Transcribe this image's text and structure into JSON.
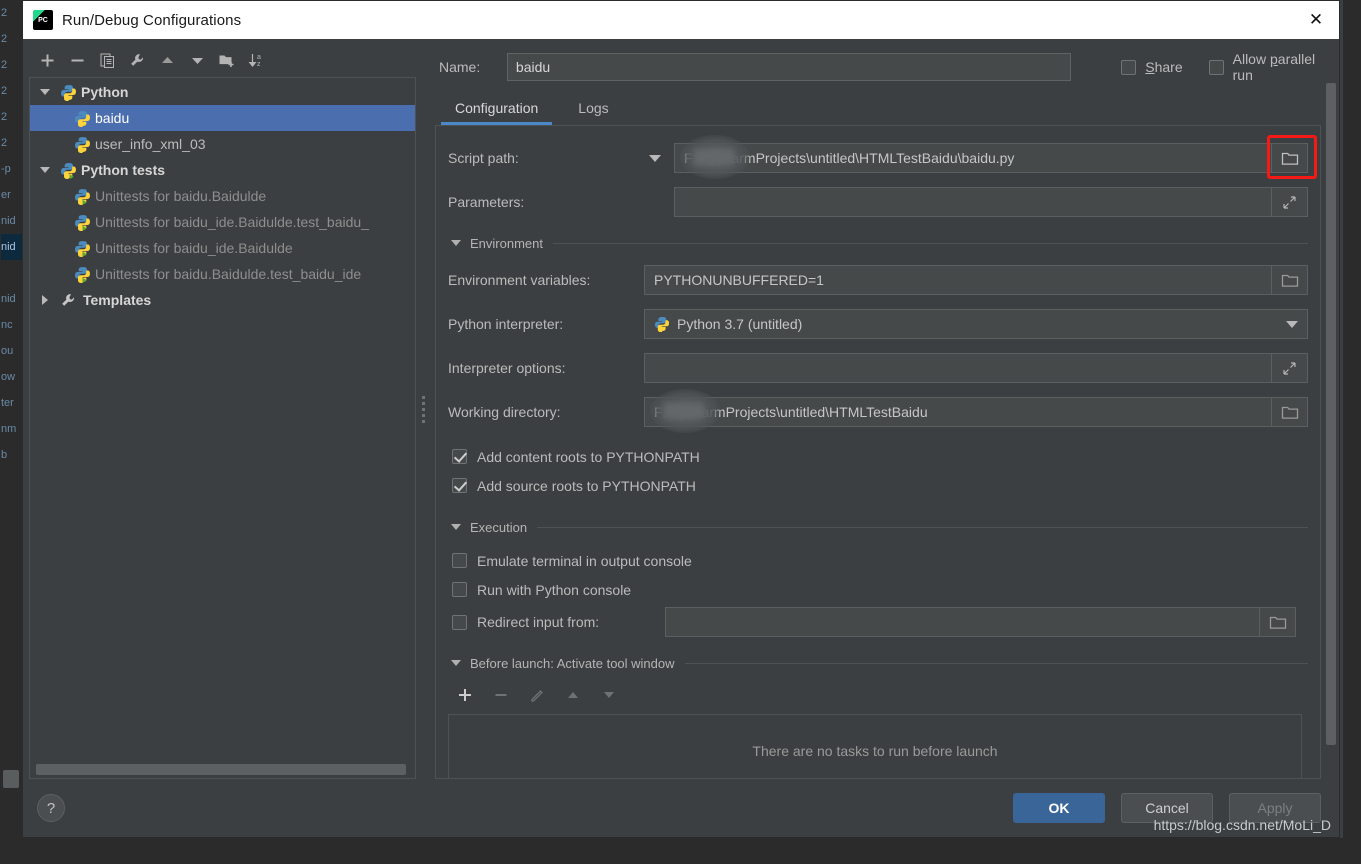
{
  "window": {
    "title": "Run/Debug Configurations",
    "app_icon": "pycharm-logo-icon",
    "close_label": "✕"
  },
  "toolbar": {
    "buttons": [
      {
        "name": "add-configuration-button",
        "icon": "plus-icon"
      },
      {
        "name": "remove-configuration-button",
        "icon": "minus-icon"
      },
      {
        "name": "copy-configuration-button",
        "icon": "copy-icon"
      },
      {
        "name": "edit-templates-button",
        "icon": "wrench-icon"
      },
      {
        "name": "move-up-button",
        "icon": "arrow-up-icon"
      },
      {
        "name": "move-down-button",
        "icon": "arrow-down-icon"
      },
      {
        "name": "new-folder-button",
        "icon": "folder-add-icon"
      },
      {
        "name": "sort-configurations-button",
        "icon": "sort-az-icon"
      }
    ]
  },
  "tree": {
    "nodes": [
      {
        "label": "Python",
        "type": "group",
        "expanded": true,
        "icon": "python-icon"
      },
      {
        "label": "baidu",
        "type": "child",
        "selected": true,
        "icon": "python-icon"
      },
      {
        "label": "user_info_xml_03",
        "type": "child",
        "selected": false,
        "icon": "python-icon"
      },
      {
        "label": "Python tests",
        "type": "group",
        "expanded": true,
        "icon": "python-test-icon"
      },
      {
        "label": "Unittests for baidu.Baidulde",
        "type": "child",
        "dim": true,
        "icon": "python-test-icon"
      },
      {
        "label": "Unittests for baidu_ide.Baidulde.test_baidu_",
        "type": "child",
        "dim": true,
        "icon": "python-test-icon"
      },
      {
        "label": "Unittests for baidu_ide.Baidulde",
        "type": "child",
        "dim": true,
        "icon": "python-test-icon"
      },
      {
        "label": "Unittests for baidu.Baidulde.test_baidu_ide",
        "type": "child",
        "dim": true,
        "icon": "python-test-icon"
      },
      {
        "label": "Templates",
        "type": "group",
        "expanded": false,
        "icon": "wrench-icon"
      }
    ]
  },
  "form": {
    "name_label": "Name:",
    "name_value": "baidu",
    "share_label": "Share",
    "share_checked": false,
    "allow_parallel_label": "Allow parallel run",
    "allow_parallel_checked": false,
    "tabs": [
      {
        "label": "Configuration",
        "active": true
      },
      {
        "label": "Logs",
        "active": false
      }
    ],
    "script_path_label": "Script path:",
    "script_path_value": "F:          PycharmProjects\\untitled\\HTMLTestBaidu\\baidu.py",
    "script_path_browse_icon": "folder-open-icon",
    "parameters_label": "Parameters:",
    "parameters_value": "",
    "parameters_expand_icon": "expand-diagonal-icon",
    "environment_section": "Environment",
    "env_vars_label": "Environment variables:",
    "env_vars_value": "PYTHONUNBUFFERED=1",
    "env_vars_browse_icon": "folder-open-icon",
    "interpreter_label": "Python interpreter:",
    "interpreter_value": "Python 3.7 (untitled)",
    "interpreter_icon": "python-icon",
    "interpreter_dropdown_icon": "chevron-down-icon",
    "interpreter_options_label": "Interpreter options:",
    "interpreter_options_value": "",
    "interpreter_options_expand_icon": "expand-diagonal-icon",
    "working_dir_label": "Working directory:",
    "working_dir_value": "F:          PycharmProjects\\untitled\\HTMLTestBaidu",
    "working_dir_browse_icon": "folder-open-icon",
    "add_content_roots_label": "Add content roots to PYTHONPATH",
    "add_content_roots_checked": true,
    "add_source_roots_label": "Add source roots to PYTHONPATH",
    "add_source_roots_checked": true,
    "execution_section": "Execution",
    "emulate_terminal_label": "Emulate terminal in output console",
    "emulate_terminal_checked": false,
    "run_with_console_label": "Run with Python console",
    "run_with_console_checked": false,
    "redirect_input_label": "Redirect input from:",
    "redirect_input_checked": false,
    "redirect_input_value": "",
    "redirect_input_browse_icon": "folder-open-icon"
  },
  "before_launch": {
    "title": "Before launch: Activate tool window",
    "buttons": [
      {
        "name": "add-task-button",
        "icon": "plus-icon",
        "enabled": true
      },
      {
        "name": "remove-task-button",
        "icon": "minus-icon",
        "enabled": false
      },
      {
        "name": "edit-task-button",
        "icon": "pencil-icon",
        "enabled": false
      },
      {
        "name": "task-move-up-button",
        "icon": "arrow-up-icon",
        "enabled": false
      },
      {
        "name": "task-move-down-button",
        "icon": "arrow-down-icon",
        "enabled": false
      }
    ],
    "empty_text": "There are no tasks to run before launch"
  },
  "footer": {
    "help_label": "?",
    "ok_label": "OK",
    "cancel_label": "Cancel",
    "apply_label": "Apply",
    "apply_enabled": false
  },
  "annotation": {
    "highlight_target": "script-path-browse-button",
    "highlight_color": "#f61a16"
  },
  "watermark": {
    "text": "https://blog.csdn.net/MoLi_D"
  },
  "background": {
    "gutter_text": "2\n2\n2\n2\n2\n2\n-p\ner\nnid\nnid\nnid\nnc\nou\now\nter\nnm\nb"
  },
  "colors": {
    "dialog_bg": "#3c3f41",
    "field_bg": "#45494a",
    "selection_blue": "#4b6eaf",
    "tab_accent": "#4a88c7",
    "ok_button": "#3a6598",
    "text_primary": "#bbbbbb",
    "titlebar_bg": "#ffffff",
    "highlight_red": "#f61a16"
  }
}
